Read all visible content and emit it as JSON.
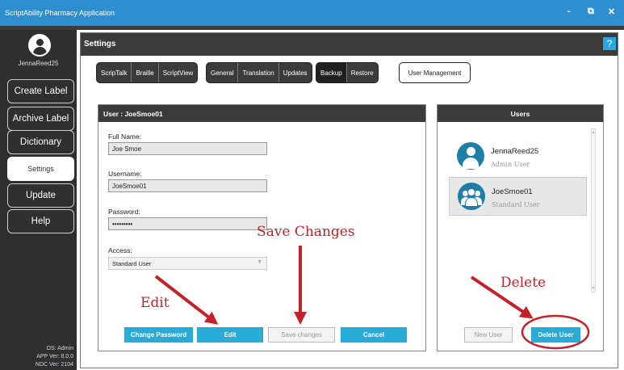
{
  "window": {
    "title": "ScriptAbility Pharmacy Application",
    "controls": {
      "minimize": "-",
      "restore": "⧉",
      "close": "✕"
    }
  },
  "sidebar": {
    "username": "JennaReed25",
    "items": [
      {
        "label": "Create Label"
      },
      {
        "label": "Archive Label"
      },
      {
        "label": "Dictionary"
      },
      {
        "label": "Settings",
        "active": true
      },
      {
        "label": "Update"
      },
      {
        "label": "Help"
      }
    ],
    "footer": {
      "os": "OS: Admin",
      "app_ver": "APP Ver: 8.0.0",
      "ndc_ver": "NDC Ver: 2104"
    }
  },
  "settings": {
    "title": "Settings",
    "help_label": "?",
    "tab_groups": [
      [
        "ScripTalk",
        "Braille",
        "ScriptView"
      ],
      [
        "General",
        "Translation",
        "Updates"
      ],
      [
        "Backup",
        "Restore"
      ]
    ],
    "user_management_label": "User Management"
  },
  "user_form": {
    "header": "User : JoeSmoe01",
    "full_name_label": "Full Name:",
    "full_name_value": "Joe Smoe",
    "username_label": "Username:",
    "username_value": "JoeSmoe01",
    "password_label": "Password:",
    "password_value": "•••••••••",
    "access_label": "Access:",
    "access_value": "Standard User",
    "buttons": {
      "change_password": "Change Password",
      "edit": "Edit",
      "save_changes": "Save changes",
      "cancel": "Cancel"
    }
  },
  "users_panel": {
    "header": "Users",
    "users": [
      {
        "name": "JennaReed25",
        "role": "Admin User"
      },
      {
        "name": "JoeSmoe01",
        "role": "Standard User",
        "selected": true
      }
    ],
    "new_user_label": "New User",
    "delete_user_label": "Delete User"
  },
  "annotations": {
    "edit": "Edit",
    "save_changes": "Save Changes",
    "delete": "Delete",
    "color": "#c6202a"
  },
  "colors": {
    "accent_blue": "#29abd7",
    "titlebar": "#2d8fd0",
    "dark": "#3b3b3b"
  }
}
